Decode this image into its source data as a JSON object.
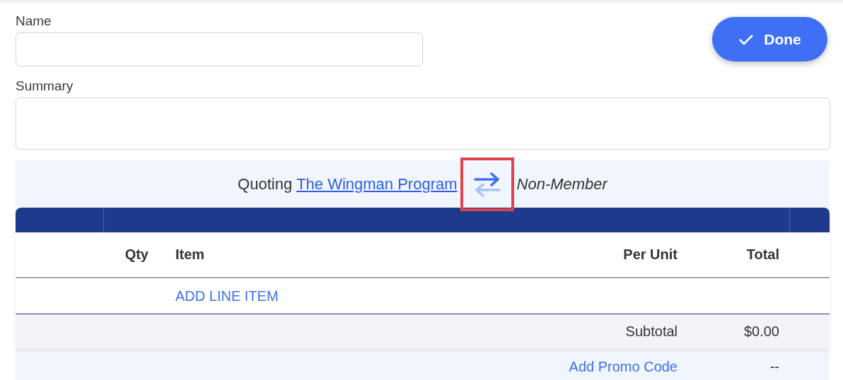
{
  "form": {
    "name_label": "Name",
    "summary_label": "Summary"
  },
  "done_button": {
    "label": "Done"
  },
  "quote": {
    "prefix": "Quoting",
    "program": "The Wingman Program",
    "swap_highlighted": true,
    "member_status": "Non-Member"
  },
  "table": {
    "columns": [
      "Qty",
      "Item",
      "Per Unit",
      "Total"
    ],
    "add_line_item": "ADD LINE ITEM",
    "subtotal": {
      "label": "Subtotal",
      "value": "$0.00"
    },
    "promo": {
      "label": "Add Promo Code",
      "value": "--"
    }
  }
}
